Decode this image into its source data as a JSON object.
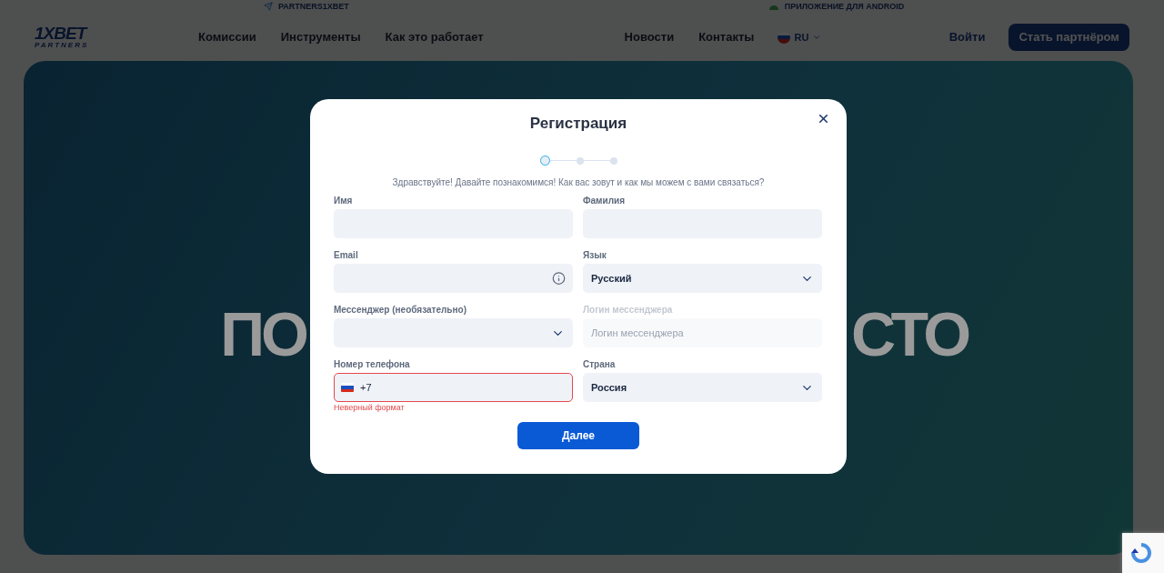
{
  "topbar": {
    "links": [
      {
        "kind": "telegram",
        "label": "PARTNERS1XBET"
      },
      {
        "kind": "android",
        "label": "ПРИЛОЖЕНИЕ ДЛЯ ANDROID"
      }
    ]
  },
  "header": {
    "logo": {
      "main": "1XBET",
      "sub": "PARTNERS"
    },
    "nav_left": [
      "Комиссии",
      "Инструменты",
      "Как это работает"
    ],
    "nav_right": [
      "Новости",
      "Контакты"
    ],
    "language": "RU",
    "login": "Войти",
    "cta": "Стать партнёром"
  },
  "hero": {
    "text_left": "ПО",
    "text_right": "СТО"
  },
  "modal": {
    "title": "Регистрация",
    "steps": [
      {
        "selected": true
      },
      {
        "selected": false
      },
      {
        "selected": false
      }
    ],
    "subtitle": "Здравствуйте! Давайте познакомимся! Как вас зовут и как мы можем с вами связаться?",
    "fields": [
      {
        "kind": "text",
        "label": "Имя"
      },
      {
        "kind": "text",
        "label": "Фамилия"
      },
      {
        "kind": "email",
        "label": "Email"
      },
      {
        "kind": "select",
        "label": "Язык",
        "value": "Русский"
      },
      {
        "kind": "select",
        "label": "Мессенджер (необязательно)"
      },
      {
        "kind": "text",
        "label": "Логин мессенджера",
        "placeholder": "Логин мессенджера",
        "disabled": true
      },
      {
        "kind": "phone",
        "label": "Номер телефона",
        "value": "+7",
        "error": true,
        "error_text": "Неверный формат"
      },
      {
        "kind": "select",
        "label": "Страна",
        "value": "Россия"
      }
    ],
    "submit": "Далее"
  }
}
